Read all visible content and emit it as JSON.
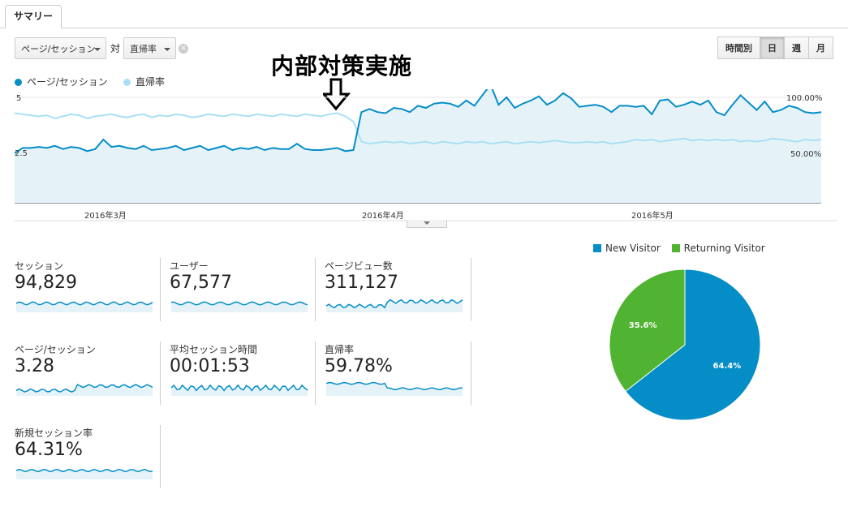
{
  "tabs": [
    {
      "label": "サマリー"
    }
  ],
  "controls": {
    "metric1": "ページ/セッション",
    "vs": "対",
    "metric2": "直帰率",
    "granularity": [
      "時間別",
      "日",
      "週",
      "月"
    ],
    "granularity_active": "日"
  },
  "annotation": "内部対策実施",
  "legend": [
    {
      "label": "ページ/セッション",
      "color": "#058dc7"
    },
    {
      "label": "直帰率",
      "color": "#aadff3"
    }
  ],
  "chart": {
    "left_ticks": [
      "5",
      "2.5"
    ],
    "right_ticks": [
      "100.00%",
      "50.00%"
    ],
    "dates": [
      "2016年3月",
      "2016年4月",
      "2016年5月"
    ]
  },
  "chart_data": {
    "type": "line",
    "x_labels": [
      "2016年3月",
      "2016年4月",
      "2016年5月"
    ],
    "series": [
      {
        "name": "ページ/セッション",
        "axis": "left",
        "ylim": [
          0,
          5
        ],
        "values": [
          2.35,
          2.6,
          2.6,
          2.65,
          2.6,
          2.7,
          2.55,
          2.65,
          2.6,
          2.45,
          2.55,
          3.0,
          2.65,
          2.7,
          2.6,
          2.55,
          2.7,
          2.5,
          2.55,
          2.6,
          2.7,
          2.5,
          2.6,
          2.7,
          2.5,
          2.6,
          2.7,
          2.5,
          2.6,
          2.55,
          2.65,
          2.5,
          2.6,
          2.55,
          2.55,
          2.8,
          2.55,
          2.5,
          2.5,
          2.55,
          2.6,
          2.45,
          2.5,
          4.3,
          4.45,
          4.3,
          4.25,
          4.5,
          4.45,
          4.3,
          4.6,
          4.5,
          4.7,
          4.75,
          4.7,
          4.55,
          4.85,
          4.6,
          5.1,
          5.6,
          4.65,
          5.0,
          4.5,
          4.7,
          4.85,
          5.05,
          4.65,
          4.85,
          5.2,
          4.95,
          4.55,
          4.6,
          4.65,
          4.55,
          4.3,
          4.6,
          4.6,
          4.55,
          4.6,
          4.2,
          4.85,
          4.9,
          4.55,
          4.65,
          4.8,
          4.65,
          4.85,
          4.3,
          4.15,
          4.65,
          5.1,
          4.75,
          4.4,
          4.8,
          4.3,
          4.4,
          4.6,
          4.5,
          4.3,
          4.25,
          4.3
        ]
      },
      {
        "name": "直帰率",
        "axis": "right",
        "ylim": [
          0,
          100
        ],
        "values": [
          85,
          84,
          83,
          82,
          83,
          80,
          82,
          84,
          83,
          80,
          82,
          83,
          84,
          82,
          81,
          83,
          84,
          81,
          83,
          82,
          84,
          83,
          81,
          82,
          84,
          83,
          82,
          84,
          83,
          82,
          84,
          83,
          82,
          84,
          83,
          82,
          84,
          83,
          82,
          84,
          85,
          82,
          77,
          58,
          56,
          57,
          58,
          57,
          58,
          56,
          57,
          58,
          56,
          58,
          57,
          56,
          58,
          57,
          58,
          56,
          57,
          58,
          56,
          57,
          58,
          57,
          58,
          59,
          58,
          57,
          57,
          58,
          57,
          58,
          56,
          57,
          58,
          60,
          59,
          60,
          58,
          59,
          60,
          61,
          59,
          60,
          59,
          60,
          59,
          60,
          58,
          59,
          58,
          59,
          61,
          60,
          59,
          58,
          60,
          59,
          60
        ]
      }
    ]
  },
  "metrics": [
    {
      "label": "セッション",
      "value": "94,829"
    },
    {
      "label": "ユーザー",
      "value": "67,577"
    },
    {
      "label": "ページビュー数",
      "value": "311,127"
    },
    {
      "label": "ページ/セッション",
      "value": "3.28"
    },
    {
      "label": "平均セッション時間",
      "value": "00:01:53"
    },
    {
      "label": "直帰率",
      "value": "59.78%"
    },
    {
      "label": "新規セッション率",
      "value": "64.31%"
    }
  ],
  "pie": {
    "legend": [
      {
        "label": "New Visitor",
        "color": "#058dc7"
      },
      {
        "label": "Returning Visitor",
        "color": "#50b432"
      }
    ],
    "chart_data": {
      "type": "pie",
      "slices": [
        {
          "label": "New Visitor",
          "value": 64.4,
          "display": "64.4%"
        },
        {
          "label": "Returning Visitor",
          "value": 35.6,
          "display": "35.6%"
        }
      ]
    }
  }
}
